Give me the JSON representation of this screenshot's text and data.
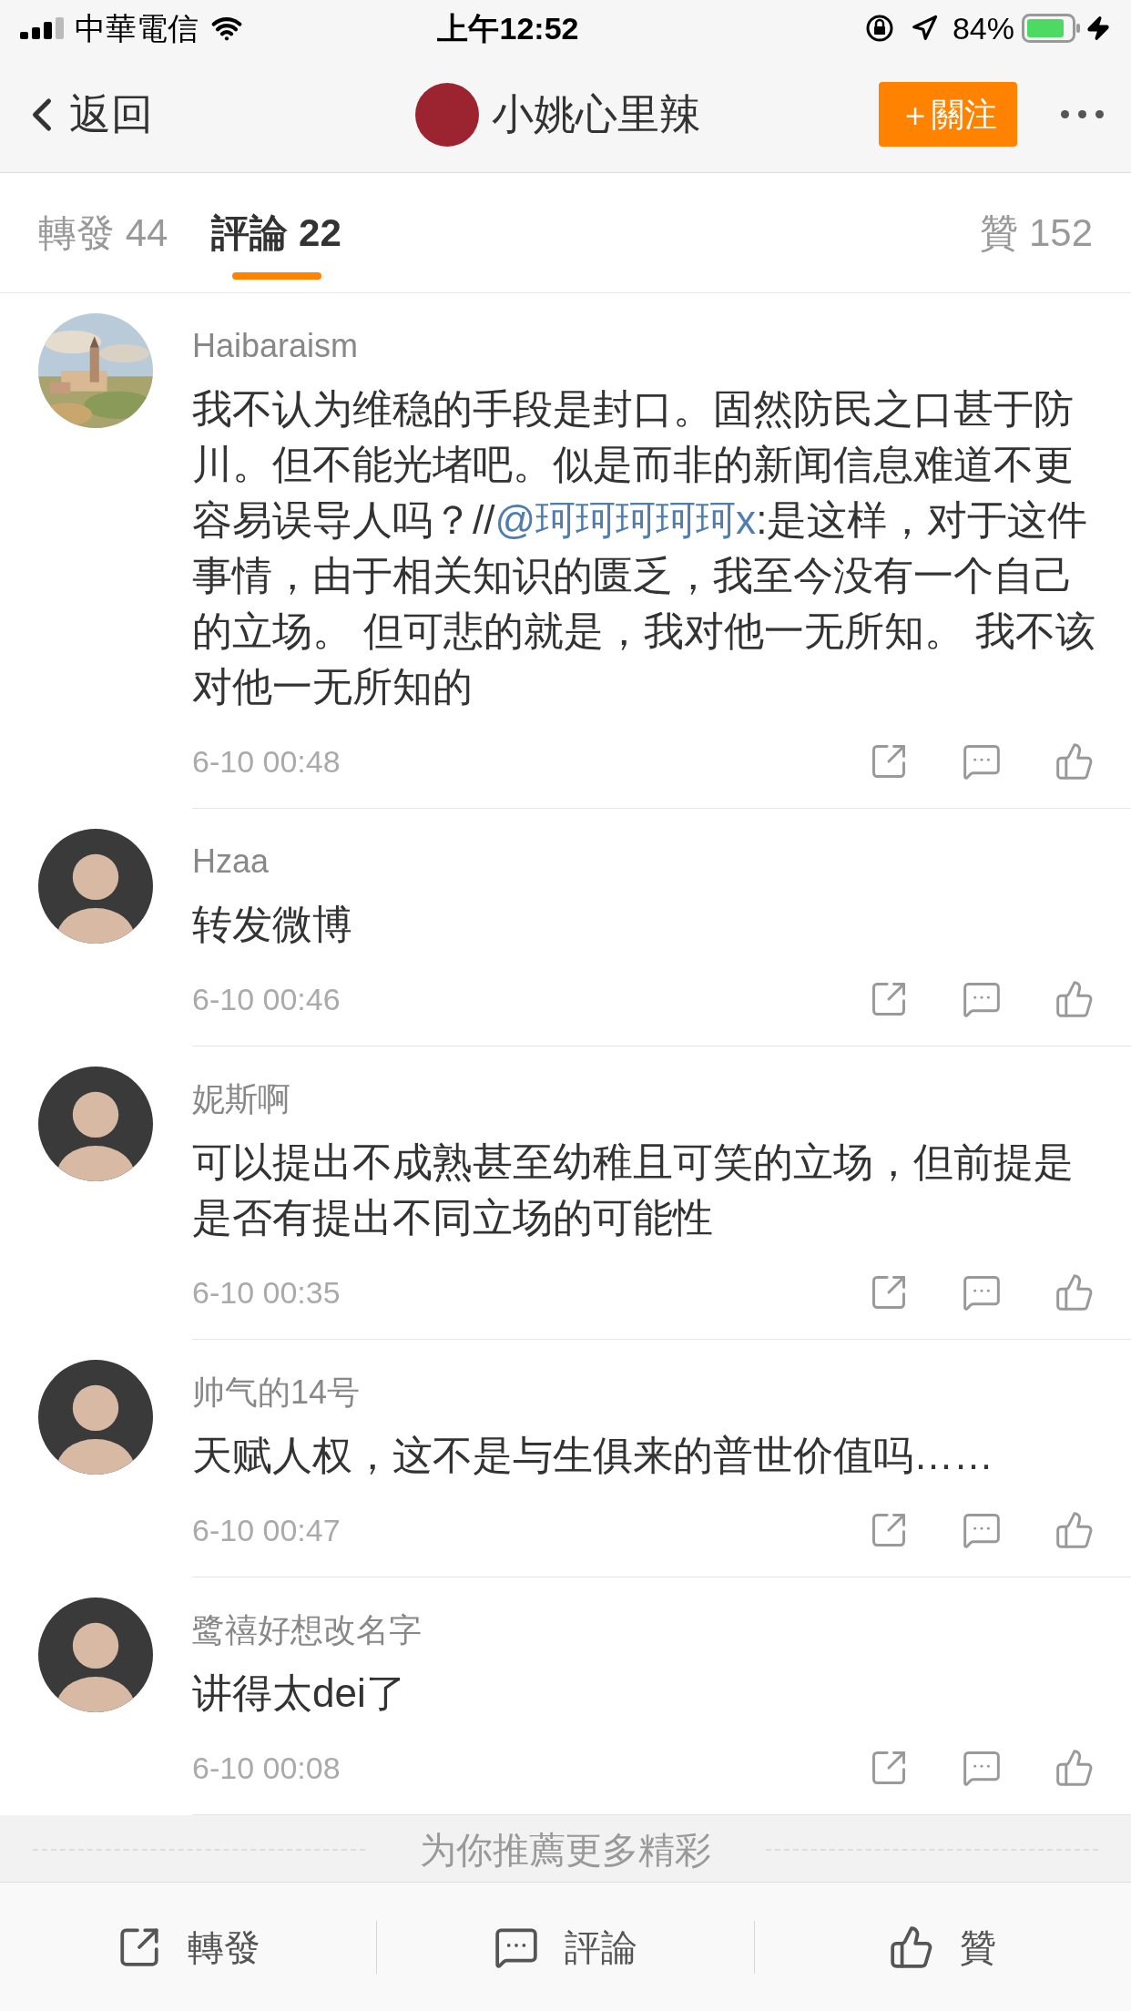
{
  "status_bar": {
    "carrier": "中華電信",
    "time": "上午12:52",
    "battery": "84%"
  },
  "header": {
    "back": "返回",
    "title": "小姚心里辣",
    "follow": "＋關注"
  },
  "tabs": [
    {
      "label": "轉發 44",
      "selected": false
    },
    {
      "label": "評論 22",
      "selected": true
    },
    {
      "label": "贊 152",
      "selected": false
    }
  ],
  "comments": [
    {
      "name": "Haibaraism",
      "parts": [
        {
          "kind": "text",
          "text": "我不认为维稳的手段是封口。固然防民之口甚于防川。但不能光堵吧。似是而非的新闻信息难道不更容易误导人吗？//"
        },
        {
          "kind": "mention",
          "text": "@珂珂珂珂珂x"
        },
        {
          "kind": "text",
          "text": ":是这样，对于这件事情，由于相关知识的匮乏，我至今没有一个自己的立场。 但可悲的就是，我对他一无所知。 我不该对他一无所知的"
        }
      ],
      "time": "6-10 00:48"
    },
    {
      "avatar": {
        "kind": "person"
      },
      "name": "Hzaa",
      "parts": [
        {
          "kind": "text",
          "text": "转发微博"
        }
      ],
      "time": "6-10 00:46"
    },
    {
      "avatar": {
        "kind": "person"
      },
      "name": "妮斯啊",
      "parts": [
        {
          "kind": "text",
          "text": "可以提出不成熟甚至幼稚且可笑的立场，但前提是是否有提出不同立场的可能性"
        }
      ],
      "time": "6-10 00:35"
    },
    {
      "avatar": {
        "kind": "person"
      },
      "name": "帅气的14号",
      "parts": [
        {
          "kind": "text",
          "text": "天赋人权，这不是与生俱来的普世价值吗……"
        }
      ],
      "time": "6-10 00:47"
    },
    {
      "avatar": {
        "kind": "person"
      },
      "name": "鹭禧好想改名字",
      "parts": [
        {
          "kind": "text",
          "text": "讲得太dei了"
        }
      ],
      "time": "6-10 00:08"
    }
  ],
  "recommend": "为你推薦更多精彩",
  "toolbar": [
    {
      "kind": "share",
      "label": "轉發"
    },
    {
      "kind": "comment",
      "label": "評論"
    },
    {
      "kind": "like",
      "label": "贊"
    }
  ]
}
